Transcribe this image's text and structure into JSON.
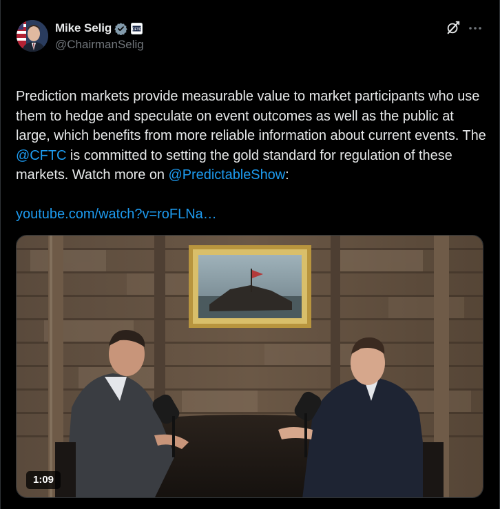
{
  "author": {
    "display_name": "Mike Selig",
    "handle": "@ChairmanSelig",
    "affiliation_badge_text": "CFTC"
  },
  "icons": {
    "verified": "verified-badge-icon",
    "grok": "grok-icon",
    "more": "more-options-icon"
  },
  "tweet": {
    "text_part1": "Prediction markets provide measurable value to market participants who use them to hedge and speculate on event outcomes as well as the public at large, which benefits from more reliable information about current events. The ",
    "mention_cftc": "@CFTC",
    "text_part2": " is committed to setting the gold standard for regulation of these markets. Watch more on ",
    "mention_show": "@PredictableShow",
    "text_part3": ":",
    "link": "youtube.com/watch?v=roFLNa…"
  },
  "video": {
    "duration": "1:09"
  },
  "colors": {
    "background": "#000000",
    "text": "#e7e9ea",
    "secondary_text": "#71767b",
    "link": "#1d9bf0",
    "border": "#2f3336",
    "verified": "#829aab"
  }
}
